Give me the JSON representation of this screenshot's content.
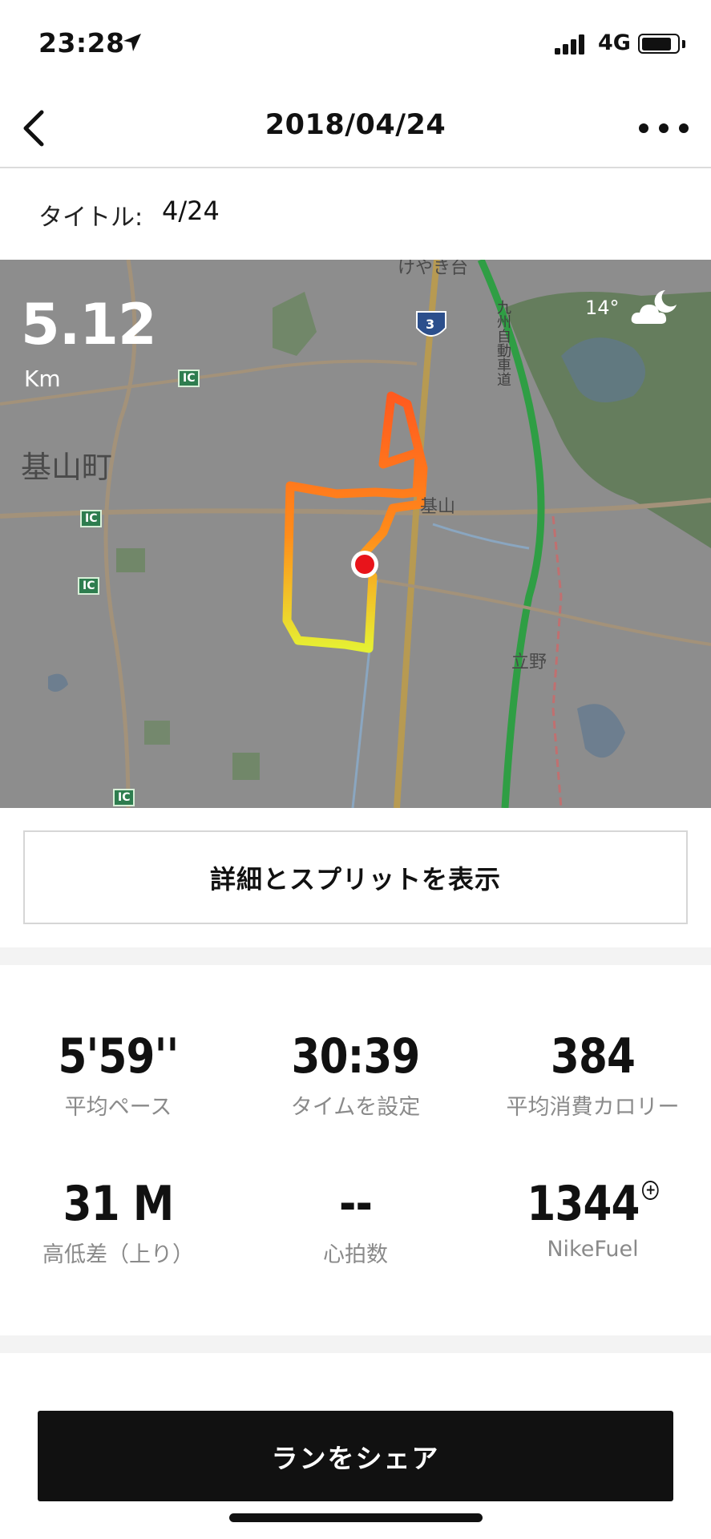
{
  "status_bar": {
    "time": "23:28",
    "network": "4G",
    "battery_level": 0.85
  },
  "nav": {
    "title": "2018/04/24"
  },
  "activity": {
    "title_label": "タイトル:",
    "title_value": "4/24"
  },
  "map": {
    "distance": "5.12",
    "distance_unit": "Km",
    "temperature": "14°",
    "weather_icon": "cloudy-night-icon",
    "labels": {
      "town": "基山町",
      "area_top": "けやき台",
      "station_kiyama": "基山",
      "station_tateno": "立野",
      "expressway": "九州自動車道",
      "route_number": "3",
      "ic": "IC"
    }
  },
  "details_button_label": "詳細とスプリットを表示",
  "stats": [
    {
      "value": "5'59''",
      "label": "平均ペース"
    },
    {
      "value": "30:39",
      "label": "タイムを設定"
    },
    {
      "value": "384",
      "label": "平均消費カロリー"
    },
    {
      "value": "31 M",
      "label": "高低差（上り）"
    },
    {
      "value": "--",
      "label": "心拍数"
    },
    {
      "value": "1344",
      "label": "NikeFuel"
    }
  ],
  "share_button_label": "ランをシェア",
  "colors": {
    "route_start": "#ff5a1f",
    "route_mid": "#ff8c1a",
    "route_end": "#e6f033",
    "marker": "#e8141b",
    "map_bg": "#8d8d8d",
    "expressway": "#2f9e44"
  }
}
